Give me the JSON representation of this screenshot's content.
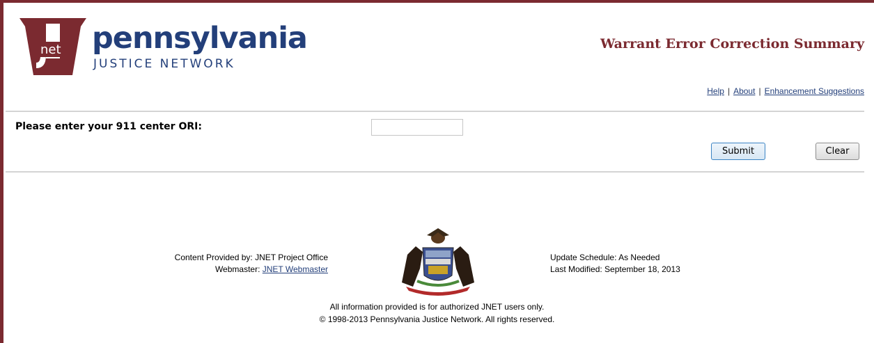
{
  "brand": {
    "logo_mark": "net",
    "name": "pennsylvania",
    "subtitle": "JUSTICE NETWORK",
    "primary_color": "#233f7a",
    "accent_color": "#7b2a30"
  },
  "header": {
    "title": "Warrant Error Correction Summary",
    "links": [
      {
        "label": "Help"
      },
      {
        "label": "About"
      },
      {
        "label": "Enhancement Suggestions"
      }
    ],
    "separator": "|"
  },
  "form": {
    "ori_label": "Please enter your 911 center ORI:",
    "ori_value": "",
    "ori_placeholder": "",
    "submit_label": "Submit",
    "clear_label": "Clear"
  },
  "footer": {
    "content_provided": "Content Provided by: JNET Project Office",
    "webmaster_label": "Webmaster:",
    "webmaster_link": "JNET Webmaster",
    "update_schedule": "Update Schedule: As Needed",
    "last_modified": "Last Modified: September 18, 2013",
    "notice": "All information provided is for authorized JNET users only.",
    "copyright": "© 1998-2013 Pennsylvania Justice Network. All rights reserved.",
    "seal_icon": "pennsylvania-coat-of-arms-icon"
  }
}
